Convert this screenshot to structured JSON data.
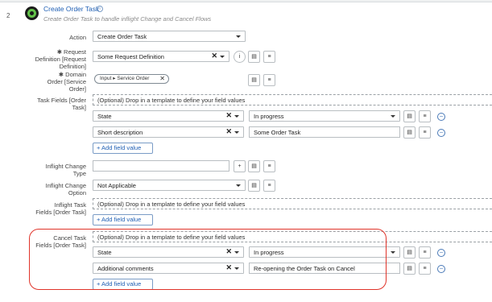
{
  "step": {
    "number": "2",
    "title": "Create Order Task",
    "description": "Create Order Task to handle  inflight Change and Cancel Flows"
  },
  "fields": {
    "action": {
      "label": "Action",
      "value": "Create Order Task"
    },
    "request_definition": {
      "label_lines": [
        "✱ Request",
        "Definition [Request",
        "Definition]"
      ],
      "value": "Some Request Definition"
    },
    "domain_order": {
      "label_lines": [
        "✱ Domain",
        "Order [Service",
        "Order]"
      ],
      "pill_path": "Input ▸ Service Order"
    },
    "task_fields": {
      "label_lines": [
        "Task Fields [Order",
        "Task]"
      ],
      "template_placeholder": "(Optional) Drop in a template to define your field values",
      "rows": [
        {
          "field": "State",
          "value": "In progress"
        },
        {
          "field": "Short description",
          "value": "Some Order Task"
        }
      ],
      "add_label": "+ Add field value"
    },
    "inflight_change_type": {
      "label_lines": [
        "Inflight Change",
        "Type"
      ],
      "value": ""
    },
    "inflight_change_option": {
      "label_lines": [
        "Inflight Change",
        "Option"
      ],
      "value": "Not Applicable"
    },
    "inflight_task_fields": {
      "label_lines": [
        "Inflight Task",
        "Fields [Order Task]"
      ],
      "template_placeholder": "(Optional) Drop in a template to define your field values",
      "add_label": "+ Add field value"
    },
    "cancel_task_fields": {
      "label_lines": [
        "Cancel Task",
        "Fields [Order Task]"
      ],
      "template_placeholder": "(Optional) Drop in a template to define your field values",
      "rows": [
        {
          "field": "State",
          "value": "In progress"
        },
        {
          "field": "Additional comments",
          "value": "Re-opening the Order Task on Cancel"
        }
      ],
      "add_label": "+ Add field value"
    }
  },
  "icons": {
    "clear": "✕",
    "info": "i",
    "plus": "+",
    "minus": "−"
  },
  "colors": {
    "link_blue": "#1f5fb4",
    "highlight_red": "#e0342a",
    "status_green": "#63c34a"
  }
}
